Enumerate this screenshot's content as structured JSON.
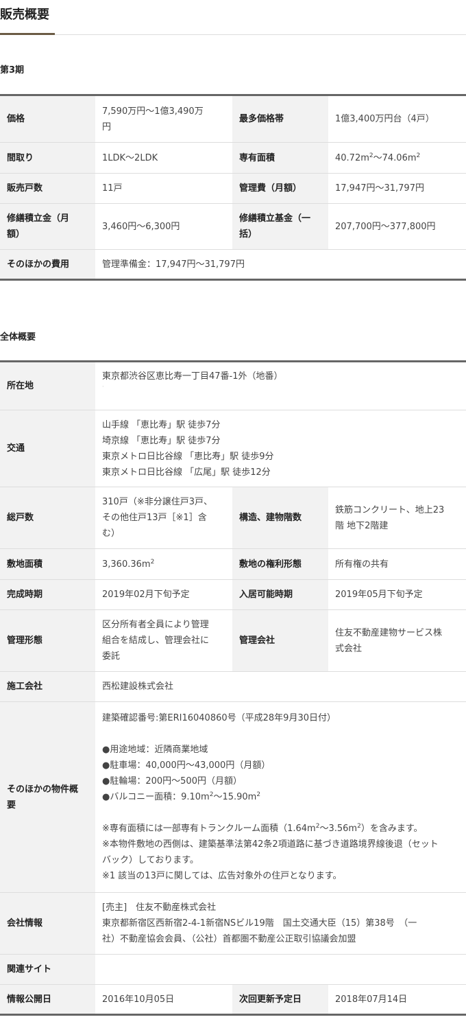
{
  "page_title": "販売概要",
  "phase_heading": "第3期",
  "overall_heading": "全体概要",
  "sales": {
    "price_label": "価格",
    "price_value_1": "7,590万円～1億3,490万",
    "price_value_2": "円",
    "top_price_label": "最多価格帯",
    "top_price_value": "1億3,400万円台（4戸）",
    "layout_label": "間取り",
    "layout_value": "1LDK～2LDK",
    "area_label": "専有面積",
    "area_from": "40.72m",
    "area_mid": "～74.06m",
    "area_sup": "2",
    "units_label": "販売戸数",
    "units_value": "11戸",
    "mgmt_fee_label": "管理費（月額）",
    "mgmt_fee_value": "17,947円～31,797円",
    "repair_label_1": "修繕積立金（月",
    "repair_label_2": "額）",
    "repair_value": "3,460円～6,300円",
    "repair_fund_label_1": "修繕積立基金（一",
    "repair_fund_label_2": "括）",
    "repair_fund_value": "207,700円～377,800円",
    "other_cost_label": "そのほかの費用",
    "other_cost_value": "管理準備金：17,947円～31,797円"
  },
  "overall": {
    "location_label": "所在地",
    "location_value": "東京都渋谷区恵比寿一丁目47番-1外（地番）",
    "access_label": "交通",
    "access_lines": [
      "山手線 「恵比寿」駅 徒歩7分",
      "埼京線 「恵比寿」駅 徒歩7分",
      "東京メトロ日比谷線 「恵比寿」駅 徒歩9分",
      "東京メトロ日比谷線 「広尾」駅 徒歩12分"
    ],
    "total_units_label": "総戸数",
    "total_units_lines": [
      "310戸（※非分譲住戸3戸、",
      "その他住戸13戸［※1］含",
      "む）"
    ],
    "structure_label": "構造、建物階数",
    "structure_lines": [
      "鉄筋コンクリート、地上23",
      "階 地下2階建"
    ],
    "site_area_label": "敷地面積",
    "site_area_value": "3,360.36m",
    "site_right_label": "敷地の権利形態",
    "site_right_value": "所有権の共有",
    "completion_label": "完成時期",
    "completion_value": "2019年02月下旬予定",
    "move_in_label": "入居可能時期",
    "move_in_value": "2019年05月下旬予定",
    "mgmt_form_label": "管理形態",
    "mgmt_form_lines": [
      "区分所有者全員により管理",
      "組合を結成し、管理会社に",
      "委託"
    ],
    "mgmt_company_label": "管理会社",
    "mgmt_company_lines": [
      "住友不動産建物サービス株",
      "式会社"
    ],
    "builder_label": "施工会社",
    "builder_value": "西松建設株式会社",
    "other_label_1": "そのほかの物件概",
    "other_label_2": "要",
    "other_confirm": "建築確認番号:第ERI16040860号（平成28年9月30日付）",
    "other_zoning": "●用途地域：近隣商業地域",
    "other_parking": "●駐車場：40,000円～43,000円（月額）",
    "other_bicycle": "●駐輪場：200円～500円（月額）",
    "other_balcony_a": "●バルコニー面積：9.10m",
    "other_balcony_b": "～15.90m",
    "other_note1_a": "※専有面積には一部専有トランクルーム面積（1.64m",
    "other_note1_b": "～3.56m",
    "other_note1_c": "）を含みます。",
    "other_note2_1": "※本物件敷地の西側は、建築基準法第42条2項道路に基づき道路境界線後退（セット",
    "other_note2_2": "バック）しております。",
    "other_note3": "※1 該当の13戸に関しては、広告対象外の住戸となります。",
    "company_label": "会社情報",
    "company_lines": [
      "[売主]　住友不動産株式会社",
      "東京都新宿区西新宿2-4-1新宿NSビル19階　国土交通大臣（15）第38号　（一",
      "社）不動産協会会員、（公社）首都圏不動産公正取引協議会加盟"
    ],
    "related_label": "関連サイト",
    "related_value": "",
    "published_label": "情報公開日",
    "published_value": "2016年10月05日",
    "next_update_label": "次回更新予定日",
    "next_update_value": "2018年07月14日"
  }
}
